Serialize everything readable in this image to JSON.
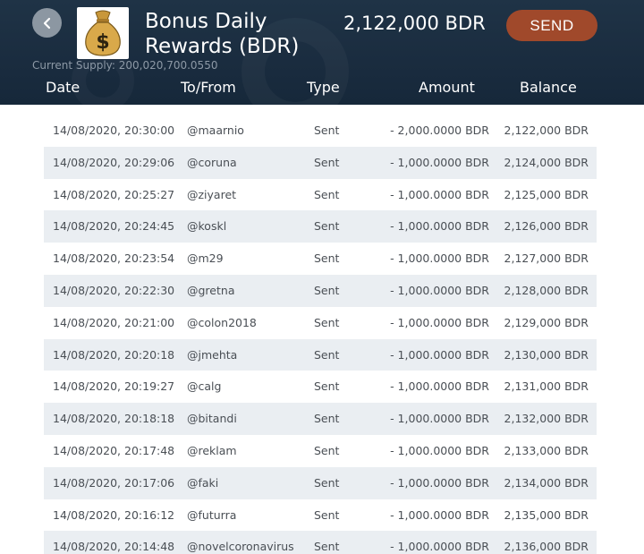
{
  "header": {
    "token_name_line1": "Bonus Daily",
    "token_name_line2": "Rewards (BDR)",
    "balance": "2,122,000 BDR",
    "send_label": "SEND",
    "supply_text": "Current Supply: 200,020,700.0550",
    "back_icon": "chevron-left-icon",
    "token_icon": "money-bag-icon"
  },
  "columns": {
    "date": "Date",
    "to_from": "To/From",
    "type": "Type",
    "amount": "Amount",
    "balance": "Balance"
  },
  "transactions": [
    {
      "date": "14/08/2020, 20:30:00",
      "user": "@maarnio",
      "type": "Sent",
      "amount": "- 2,000.0000 BDR",
      "balance": "2,122,000 BDR"
    },
    {
      "date": "14/08/2020, 20:29:06",
      "user": "@coruna",
      "type": "Sent",
      "amount": "- 1,000.0000 BDR",
      "balance": "2,124,000 BDR"
    },
    {
      "date": "14/08/2020, 20:25:27",
      "user": "@ziyaret",
      "type": "Sent",
      "amount": "- 1,000.0000 BDR",
      "balance": "2,125,000 BDR"
    },
    {
      "date": "14/08/2020, 20:24:45",
      "user": "@koskl",
      "type": "Sent",
      "amount": "- 1,000.0000 BDR",
      "balance": "2,126,000 BDR"
    },
    {
      "date": "14/08/2020, 20:23:54",
      "user": "@m29",
      "type": "Sent",
      "amount": "- 1,000.0000 BDR",
      "balance": "2,127,000 BDR"
    },
    {
      "date": "14/08/2020, 20:22:30",
      "user": "@gretna",
      "type": "Sent",
      "amount": "- 1,000.0000 BDR",
      "balance": "2,128,000 BDR"
    },
    {
      "date": "14/08/2020, 20:21:00",
      "user": "@colon2018",
      "type": "Sent",
      "amount": "- 1,000.0000 BDR",
      "balance": "2,129,000 BDR"
    },
    {
      "date": "14/08/2020, 20:20:18",
      "user": "@jmehta",
      "type": "Sent",
      "amount": "- 1,000.0000 BDR",
      "balance": "2,130,000 BDR"
    },
    {
      "date": "14/08/2020, 20:19:27",
      "user": "@calg",
      "type": "Sent",
      "amount": "- 1,000.0000 BDR",
      "balance": "2,131,000 BDR"
    },
    {
      "date": "14/08/2020, 20:18:18",
      "user": "@bitandi",
      "type": "Sent",
      "amount": "- 1,000.0000 BDR",
      "balance": "2,132,000 BDR"
    },
    {
      "date": "14/08/2020, 20:17:48",
      "user": "@reklam",
      "type": "Sent",
      "amount": "- 1,000.0000 BDR",
      "balance": "2,133,000 BDR"
    },
    {
      "date": "14/08/2020, 20:17:06",
      "user": "@faki",
      "type": "Sent",
      "amount": "- 1,000.0000 BDR",
      "balance": "2,134,000 BDR"
    },
    {
      "date": "14/08/2020, 20:16:12",
      "user": "@futurra",
      "type": "Sent",
      "amount": "- 1,000.0000 BDR",
      "balance": "2,135,000 BDR"
    },
    {
      "date": "14/08/2020, 20:14:48",
      "user": "@novelcoronavirus",
      "type": "Sent",
      "amount": "- 1,000.0000 BDR",
      "balance": "2,136,000 BDR"
    }
  ]
}
